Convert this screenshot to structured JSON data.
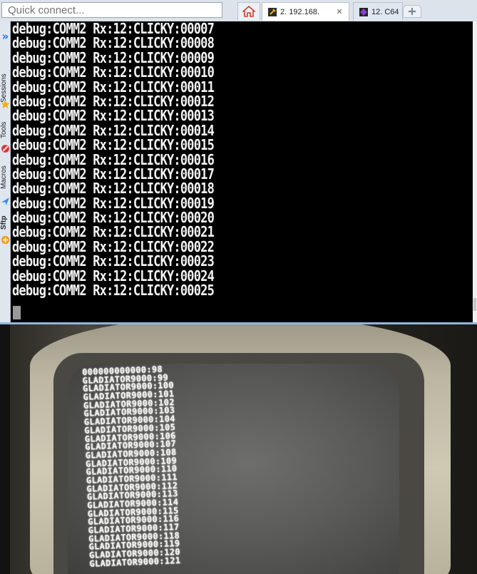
{
  "toolbar": {
    "quick_connect_placeholder": "Quick connect..."
  },
  "tabs": [
    {
      "label": "2. 192.168.",
      "active": true,
      "icon": "wrench-icon"
    },
    {
      "label": "12. C64",
      "active": false,
      "icon": "purple-gem-icon"
    }
  ],
  "sidebar": {
    "items": [
      {
        "label": "Sessions",
        "icon": "star-icon"
      },
      {
        "label": "Tools",
        "icon": "tools-icon"
      },
      {
        "label": "Macros",
        "icon": "paper-plane-icon"
      },
      {
        "label": "Sftp",
        "icon": "sftp-icon"
      }
    ]
  },
  "terminal": {
    "lines": [
      "debug:COMM2 Rx:12:CLICKY:00007",
      "debug:COMM2 Rx:12:CLICKY:00008",
      "debug:COMM2 Rx:12:CLICKY:00009",
      "debug:COMM2 Rx:12:CLICKY:00010",
      "debug:COMM2 Rx:12:CLICKY:00011",
      "debug:COMM2 Rx:12:CLICKY:00012",
      "debug:COMM2 Rx:12:CLICKY:00013",
      "debug:COMM2 Rx:12:CLICKY:00014",
      "debug:COMM2 Rx:12:CLICKY:00015",
      "debug:COMM2 Rx:12:CLICKY:00016",
      "debug:COMM2 Rx:12:CLICKY:00017",
      "debug:COMM2 Rx:12:CLICKY:00018",
      "debug:COMM2 Rx:12:CLICKY:00019",
      "debug:COMM2 Rx:12:CLICKY:00020",
      "debug:COMM2 Rx:12:CLICKY:00021",
      "debug:COMM2 Rx:12:CLICKY:00022",
      "debug:COMM2 Rx:12:CLICKY:00023",
      "debug:COMM2 Rx:12:CLICKY:00024",
      "debug:COMM2 Rx:12:CLICKY:00025"
    ]
  },
  "crt": {
    "lines": [
      "000000000000:98",
      "GLADIATOR9000:99",
      "GLADIATOR9000:100",
      "GLADIATOR9000:101",
      "GLADIATOR9000:102",
      "GLADIATOR9000:103",
      "GLADIATOR9000:104",
      "GLADIATOR9000:105",
      "GLADIATOR9000:106",
      "GLADIATOR9000:107",
      "GLADIATOR9000:108",
      "GLADIATOR9000:109",
      "GLADIATOR9000:110",
      "GLADIATOR9000:111",
      "GLADIATOR9000:112",
      "GLADIATOR9000:113",
      "GLADIATOR9000:114",
      "GLADIATOR9000:115",
      "GLADIATOR9000:116",
      "GLADIATOR9000:117",
      "GLADIATOR9000:118",
      "GLADIATOR9000:119",
      "GLADIATOR9000:120",
      "GLADIATOR9000:121"
    ]
  },
  "colors": {
    "terminal_bg": "#000000",
    "terminal_text": "#f4f4f4",
    "accent_blue": "#1a74d4",
    "home_red": "#d43a2a"
  }
}
